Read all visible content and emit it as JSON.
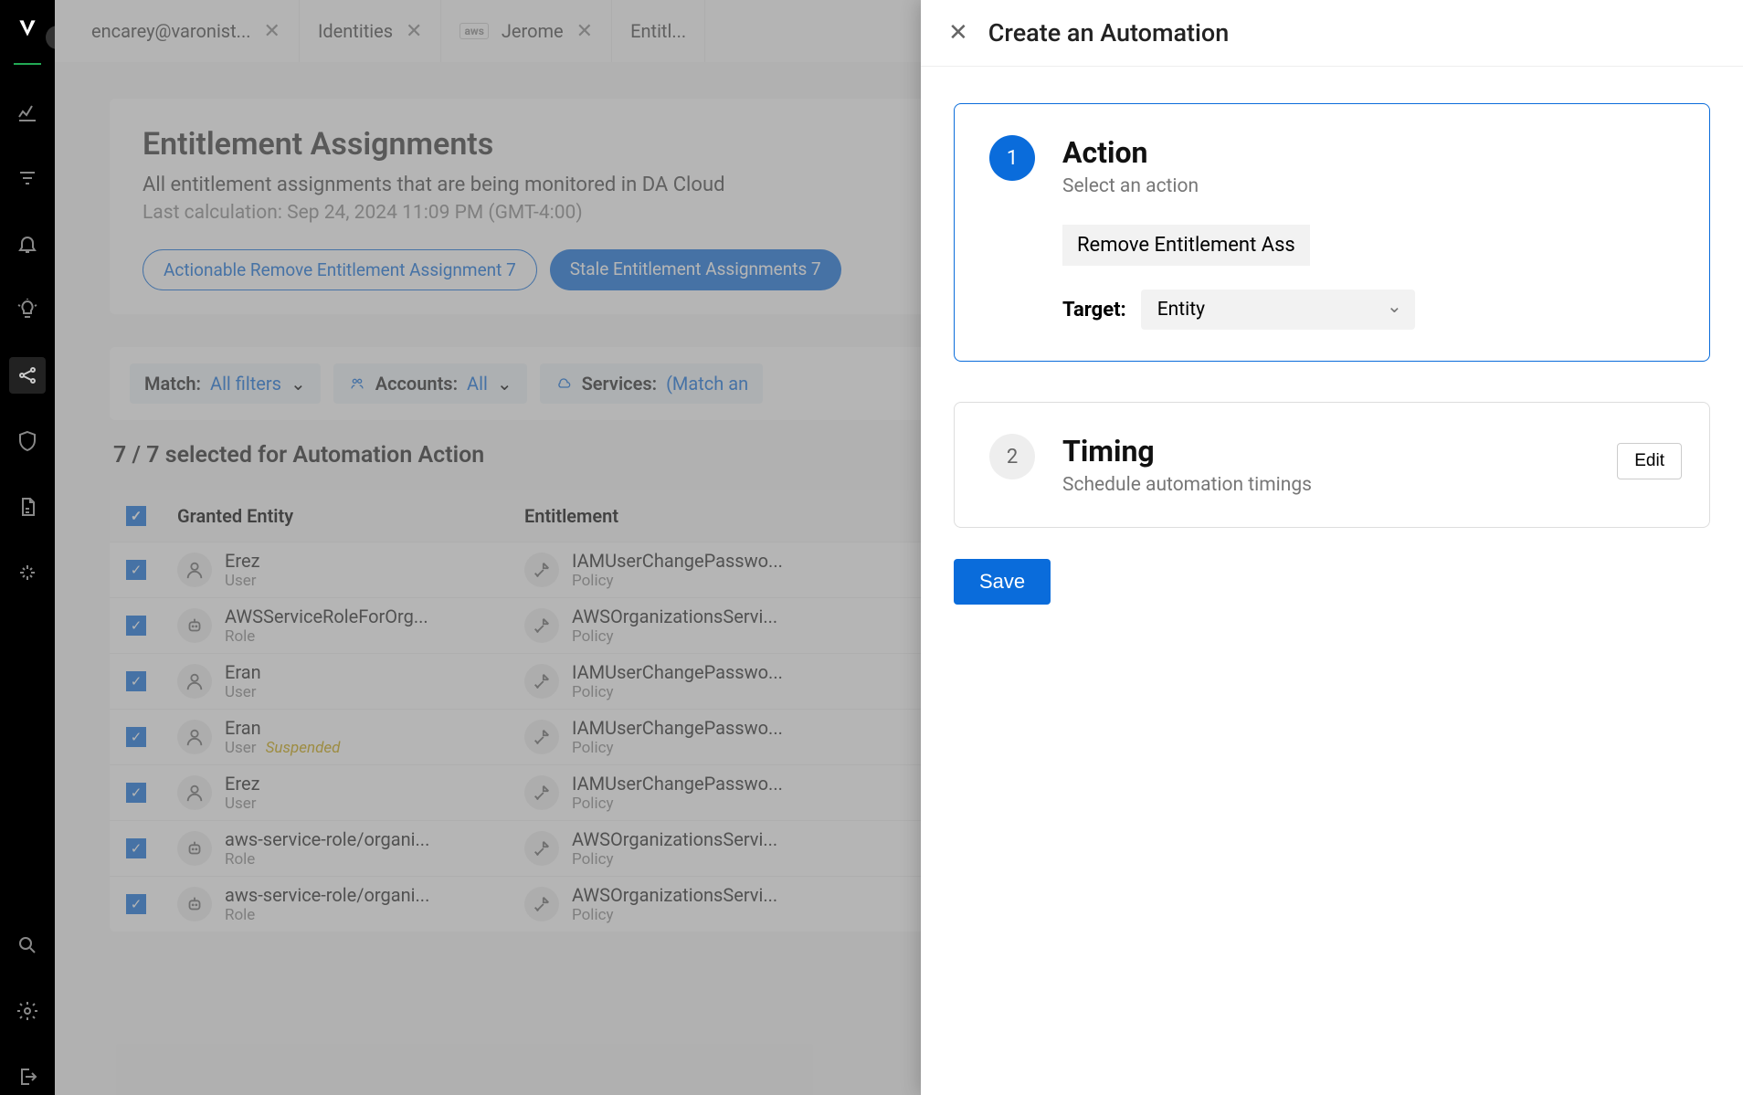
{
  "tabs": [
    {
      "label": "encarey@varonist...",
      "hasClose": true
    },
    {
      "label": "Identities",
      "hasClose": true
    },
    {
      "label": "Jerome",
      "hasClose": true,
      "aws": true
    },
    {
      "label": "Entitl...",
      "hasClose": false
    }
  ],
  "page": {
    "title": "Entitlement Assignments",
    "subtitle": "All entitlement assignments that are being monitored in DA Cloud",
    "meta": "Last calculation: Sep 24, 2024 11:09 PM (GMT-4:00)"
  },
  "pills": {
    "actionable": "Actionable Remove Entitlement Assignment 7",
    "stale": "Stale Entitlement Assignments 7"
  },
  "filters": {
    "match": {
      "label": "Match:",
      "value": "All filters"
    },
    "accounts": {
      "label": "Accounts:",
      "value": "All"
    },
    "services": {
      "label": "Services:",
      "value": "(Match an"
    }
  },
  "selection": "7 / 7 selected for Automation Action",
  "columns": {
    "entity": "Granted Entity",
    "entitlement": "Entitlement"
  },
  "rows": [
    {
      "entity": {
        "name": "Erez",
        "type": "User",
        "icon": "person"
      },
      "ent": {
        "name": "IAMUserChangePasswo...",
        "type": "Policy"
      }
    },
    {
      "entity": {
        "name": "AWSServiceRoleForOrg...",
        "type": "Role",
        "icon": "robot"
      },
      "ent": {
        "name": "AWSOrganizationsServi...",
        "type": "Policy"
      }
    },
    {
      "entity": {
        "name": "Eran",
        "type": "User",
        "icon": "person"
      },
      "ent": {
        "name": "IAMUserChangePasswo...",
        "type": "Policy"
      }
    },
    {
      "entity": {
        "name": "Eran",
        "type": "User",
        "icon": "person",
        "suspended": "Suspended"
      },
      "ent": {
        "name": "IAMUserChangePasswo...",
        "type": "Policy"
      }
    },
    {
      "entity": {
        "name": "Erez",
        "type": "User",
        "icon": "person"
      },
      "ent": {
        "name": "IAMUserChangePasswo...",
        "type": "Policy"
      }
    },
    {
      "entity": {
        "name": "aws-service-role/organi...",
        "type": "Role",
        "icon": "robot"
      },
      "ent": {
        "name": "AWSOrganizationsServi...",
        "type": "Policy"
      }
    },
    {
      "entity": {
        "name": "aws-service-role/organi...",
        "type": "Role",
        "icon": "robot"
      },
      "ent": {
        "name": "AWSOrganizationsServi...",
        "type": "Policy"
      }
    }
  ],
  "panel": {
    "title": "Create an Automation",
    "step1": {
      "title": "Action",
      "sub": "Select an action",
      "chip": "Remove Entitlement Ass",
      "targetLabel": "Target:",
      "targetValue": "Entity"
    },
    "step2": {
      "title": "Timing",
      "sub": "Schedule automation timings",
      "edit": "Edit"
    },
    "save": "Save"
  }
}
